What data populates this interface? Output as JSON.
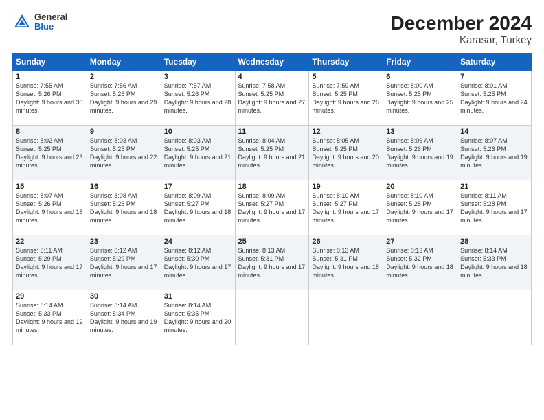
{
  "header": {
    "logo_line1": "General",
    "logo_line2": "Blue",
    "title": "December 2024",
    "subtitle": "Karasar, Turkey"
  },
  "days_of_week": [
    "Sunday",
    "Monday",
    "Tuesday",
    "Wednesday",
    "Thursday",
    "Friday",
    "Saturday"
  ],
  "weeks": [
    [
      {
        "day": "1",
        "sunrise": "7:55 AM",
        "sunset": "5:26 PM",
        "daylight": "9 hours and 30 minutes."
      },
      {
        "day": "2",
        "sunrise": "7:56 AM",
        "sunset": "5:26 PM",
        "daylight": "9 hours and 29 minutes."
      },
      {
        "day": "3",
        "sunrise": "7:57 AM",
        "sunset": "5:26 PM",
        "daylight": "9 hours and 28 minutes."
      },
      {
        "day": "4",
        "sunrise": "7:58 AM",
        "sunset": "5:25 PM",
        "daylight": "9 hours and 27 minutes."
      },
      {
        "day": "5",
        "sunrise": "7:59 AM",
        "sunset": "5:25 PM",
        "daylight": "9 hours and 26 minutes."
      },
      {
        "day": "6",
        "sunrise": "8:00 AM",
        "sunset": "5:25 PM",
        "daylight": "9 hours and 25 minutes."
      },
      {
        "day": "7",
        "sunrise": "8:01 AM",
        "sunset": "5:25 PM",
        "daylight": "9 hours and 24 minutes."
      }
    ],
    [
      {
        "day": "8",
        "sunrise": "8:02 AM",
        "sunset": "5:25 PM",
        "daylight": "9 hours and 23 minutes."
      },
      {
        "day": "9",
        "sunrise": "8:03 AM",
        "sunset": "5:25 PM",
        "daylight": "9 hours and 22 minutes."
      },
      {
        "day": "10",
        "sunrise": "8:03 AM",
        "sunset": "5:25 PM",
        "daylight": "9 hours and 21 minutes."
      },
      {
        "day": "11",
        "sunrise": "8:04 AM",
        "sunset": "5:25 PM",
        "daylight": "9 hours and 21 minutes."
      },
      {
        "day": "12",
        "sunrise": "8:05 AM",
        "sunset": "5:25 PM",
        "daylight": "9 hours and 20 minutes."
      },
      {
        "day": "13",
        "sunrise": "8:06 AM",
        "sunset": "5:26 PM",
        "daylight": "9 hours and 19 minutes."
      },
      {
        "day": "14",
        "sunrise": "8:07 AM",
        "sunset": "5:26 PM",
        "daylight": "9 hours and 19 minutes."
      }
    ],
    [
      {
        "day": "15",
        "sunrise": "8:07 AM",
        "sunset": "5:26 PM",
        "daylight": "9 hours and 18 minutes."
      },
      {
        "day": "16",
        "sunrise": "8:08 AM",
        "sunset": "5:26 PM",
        "daylight": "9 hours and 18 minutes."
      },
      {
        "day": "17",
        "sunrise": "8:09 AM",
        "sunset": "5:27 PM",
        "daylight": "9 hours and 18 minutes."
      },
      {
        "day": "18",
        "sunrise": "8:09 AM",
        "sunset": "5:27 PM",
        "daylight": "9 hours and 17 minutes."
      },
      {
        "day": "19",
        "sunrise": "8:10 AM",
        "sunset": "5:27 PM",
        "daylight": "9 hours and 17 minutes."
      },
      {
        "day": "20",
        "sunrise": "8:10 AM",
        "sunset": "5:28 PM",
        "daylight": "9 hours and 17 minutes."
      },
      {
        "day": "21",
        "sunrise": "8:11 AM",
        "sunset": "5:28 PM",
        "daylight": "9 hours and 17 minutes."
      }
    ],
    [
      {
        "day": "22",
        "sunrise": "8:11 AM",
        "sunset": "5:29 PM",
        "daylight": "9 hours and 17 minutes."
      },
      {
        "day": "23",
        "sunrise": "8:12 AM",
        "sunset": "5:29 PM",
        "daylight": "9 hours and 17 minutes."
      },
      {
        "day": "24",
        "sunrise": "8:12 AM",
        "sunset": "5:30 PM",
        "daylight": "9 hours and 17 minutes."
      },
      {
        "day": "25",
        "sunrise": "8:13 AM",
        "sunset": "5:31 PM",
        "daylight": "9 hours and 17 minutes."
      },
      {
        "day": "26",
        "sunrise": "8:13 AM",
        "sunset": "5:31 PM",
        "daylight": "9 hours and 18 minutes."
      },
      {
        "day": "27",
        "sunrise": "8:13 AM",
        "sunset": "5:32 PM",
        "daylight": "9 hours and 18 minutes."
      },
      {
        "day": "28",
        "sunrise": "8:14 AM",
        "sunset": "5:33 PM",
        "daylight": "9 hours and 18 minutes."
      }
    ],
    [
      {
        "day": "29",
        "sunrise": "8:14 AM",
        "sunset": "5:33 PM",
        "daylight": "9 hours and 19 minutes."
      },
      {
        "day": "30",
        "sunrise": "8:14 AM",
        "sunset": "5:34 PM",
        "daylight": "9 hours and 19 minutes."
      },
      {
        "day": "31",
        "sunrise": "8:14 AM",
        "sunset": "5:35 PM",
        "daylight": "9 hours and 20 minutes."
      },
      null,
      null,
      null,
      null
    ]
  ],
  "cell_labels": {
    "sunrise": "Sunrise: ",
    "sunset": "Sunset: ",
    "daylight": "Daylight: "
  }
}
